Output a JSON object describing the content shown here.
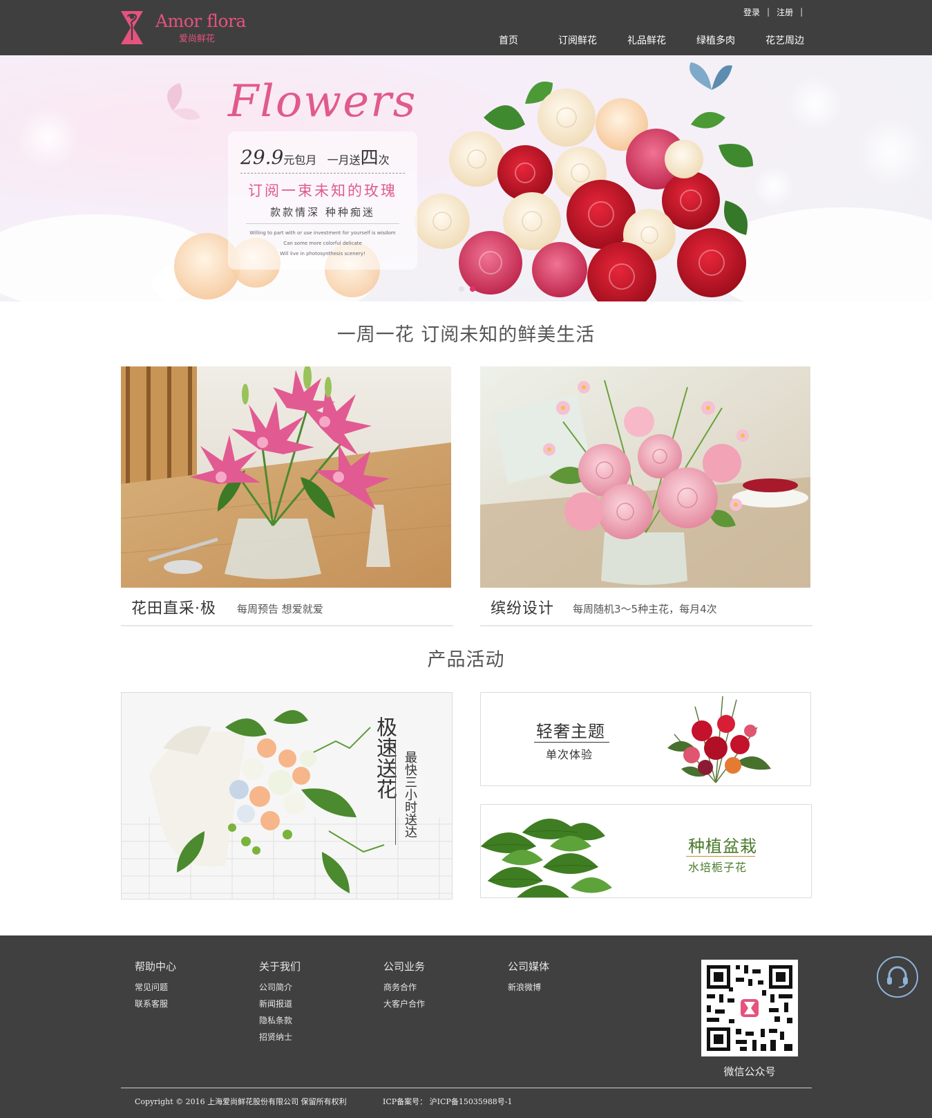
{
  "header": {
    "logo_name": "Amor flora",
    "logo_sub": "爱尚鲜花",
    "login": "登录",
    "register": "注册",
    "separator": "|",
    "nav": [
      "首页",
      "订阅鲜花",
      "礼品鲜花",
      "绿植多肉",
      "花艺周边"
    ]
  },
  "banner": {
    "script_title": "Flowers",
    "price": "29.9",
    "price_unit": "元包月",
    "per_month": "一月送",
    "times_big": "四",
    "times_unit": "次",
    "headline": "订阅一束未知的玫瑰",
    "subline": "款款情深  种种痴迷",
    "small_lines": [
      "Willing to part with or use investment for yourself is wisdom",
      "Can some more colorful delicate",
      "Will live in photosynthesis scenery!"
    ],
    "slide_count": 2,
    "active_slide": 2
  },
  "weekly": {
    "title": "一周一花 订阅未知的鲜美生活",
    "cards": [
      {
        "title": "花田直采·极",
        "subtitle": "每周预告 想爱就爱"
      },
      {
        "title": "缤纷设计",
        "subtitle": "每周随机3～5种主花，每月4次"
      }
    ]
  },
  "activities": {
    "title": "产品活动",
    "express": {
      "main": "极速送花",
      "side": "最快三小时送达"
    },
    "luxury": {
      "title": "轻奢主题",
      "subtitle": "单次体验"
    },
    "plant": {
      "title": "种植盆栽",
      "subtitle": "水培栀子花"
    }
  },
  "footer": {
    "columns": [
      {
        "heading": "帮助中心",
        "items": [
          "常见问题",
          "联系客服"
        ]
      },
      {
        "heading": "关于我们",
        "items": [
          "公司简介",
          "新闻报道",
          "隐私条款",
          "招贤纳士"
        ]
      },
      {
        "heading": "公司业务",
        "items": [
          "商务合作",
          "大客户合作"
        ]
      },
      {
        "heading": "公司媒体",
        "items": [
          "新浪微博"
        ]
      }
    ],
    "qr_label": "微信公众号",
    "copyright": "Copyright © 2016 上海爱尚鲜花股份有限公司 保留所有权利",
    "icp": "ICP备案号：  沪ICP备15035988号-1"
  },
  "colors": {
    "brand_pink": "#e5537f",
    "header_bg": "#3f3f3f",
    "footer_bg": "#404040",
    "plant_green": "#4a7a2c",
    "service_blue": "#8fb2d8"
  }
}
